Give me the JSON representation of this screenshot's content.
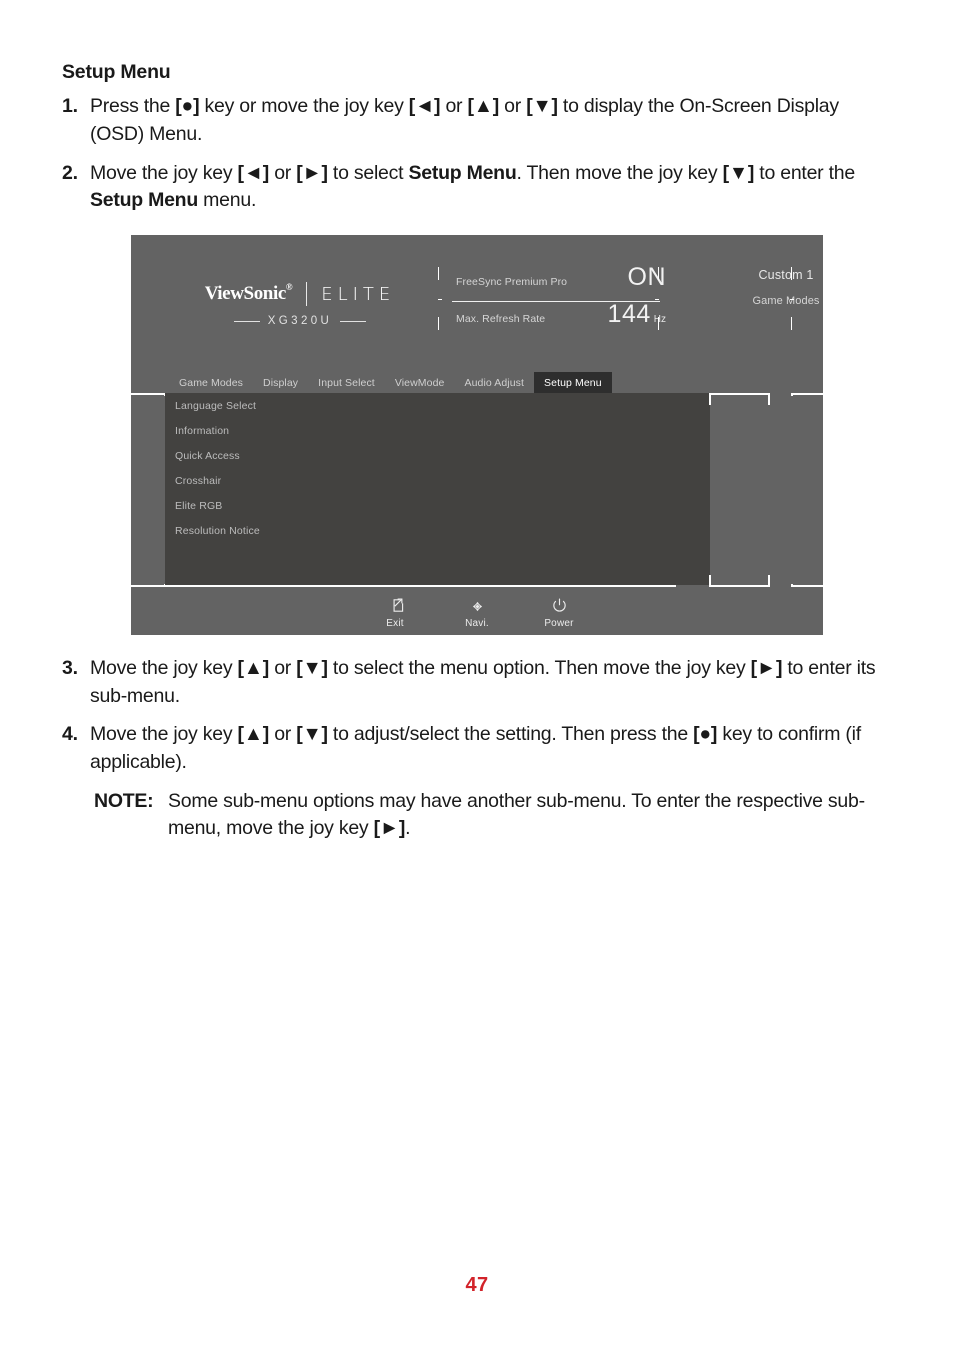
{
  "document": {
    "section_title": "Setup Menu",
    "steps_top": [
      {
        "num": "1.",
        "parts": [
          {
            "t": "Press the ",
            "bold": false
          },
          {
            "t": "[●]",
            "bold": true
          },
          {
            "t": " key or move the joy key ",
            "bold": false
          },
          {
            "t": "[◄]",
            "bold": true
          },
          {
            "t": " or ",
            "bold": false
          },
          {
            "t": "[▲]",
            "bold": true
          },
          {
            "t": " or ",
            "bold": false
          },
          {
            "t": "[▼]",
            "bold": true
          },
          {
            "t": " to display the On-Screen Display (OSD) Menu.",
            "bold": false
          }
        ]
      },
      {
        "num": "2.",
        "parts": [
          {
            "t": "Move the joy key ",
            "bold": false
          },
          {
            "t": "[◄]",
            "bold": true
          },
          {
            "t": " or ",
            "bold": false
          },
          {
            "t": "[►]",
            "bold": true
          },
          {
            "t": " to select ",
            "bold": false
          },
          {
            "t": "Setup Menu",
            "bold": true
          },
          {
            "t": ". Then move the joy key ",
            "bold": false
          },
          {
            "t": "[▼]",
            "bold": true
          },
          {
            "t": " to enter the ",
            "bold": false
          },
          {
            "t": "Setup Menu",
            "bold": true
          },
          {
            "t": " menu.",
            "bold": false
          }
        ]
      }
    ],
    "steps_bottom": [
      {
        "num": "3.",
        "parts": [
          {
            "t": "Move the joy key ",
            "bold": false
          },
          {
            "t": "[▲]",
            "bold": true
          },
          {
            "t": " or ",
            "bold": false
          },
          {
            "t": "[▼]",
            "bold": true
          },
          {
            "t": " to select the menu option. Then move the joy key ",
            "bold": false
          },
          {
            "t": "[►]",
            "bold": true
          },
          {
            "t": " to enter its sub-menu.",
            "bold": false
          }
        ]
      },
      {
        "num": "4.",
        "parts": [
          {
            "t": "Move the joy key ",
            "bold": false
          },
          {
            "t": "[▲]",
            "bold": true
          },
          {
            "t": " or ",
            "bold": false
          },
          {
            "t": "[▼]",
            "bold": true
          },
          {
            "t": " to adjust/select the setting. Then press the ",
            "bold": false
          },
          {
            "t": "[●]",
            "bold": true
          },
          {
            "t": " key to confirm (if applicable).",
            "bold": false
          }
        ]
      }
    ],
    "note": {
      "label": "NOTE:",
      "parts": [
        {
          "t": "Some sub-menu options may have another sub-menu. To enter the respective sub-menu, move the joy key ",
          "bold": false
        },
        {
          "t": "[►]",
          "bold": true
        },
        {
          "t": ".",
          "bold": false
        }
      ]
    },
    "page_number": "47"
  },
  "osd": {
    "brand": {
      "vendor": "ViewSonic",
      "vendor_mark": "®",
      "sub_brand": "ELITE",
      "model": "XG320U"
    },
    "status": [
      {
        "label": "FreeSync Premium Pro",
        "value": "ON",
        "unit": ""
      },
      {
        "label": "Max. Refresh Rate",
        "value": "144",
        "unit": "Hz"
      }
    ],
    "mode": {
      "value": "Custom 1",
      "label": "Game Modes"
    },
    "tabs": [
      {
        "label": "Game Modes",
        "active": false
      },
      {
        "label": "Display",
        "active": false
      },
      {
        "label": "Input Select",
        "active": false
      },
      {
        "label": "ViewMode",
        "active": false
      },
      {
        "label": "Audio Adjust",
        "active": false
      },
      {
        "label": "Setup Menu",
        "active": true
      }
    ],
    "submenu_items": [
      "Language Select",
      "Information",
      "Quick Access",
      "Crosshair",
      "Elite RGB",
      "Resolution Notice"
    ],
    "footer_buttons": [
      {
        "icon": "exit-icon",
        "label": "Exit"
      },
      {
        "icon": "navigate-icon",
        "label": "Navi."
      },
      {
        "icon": "power-icon",
        "label": "Power"
      }
    ],
    "colors": {
      "background": "#636363",
      "submenu_background": "#434240",
      "active_tab_background": "#2e2e2e",
      "text": "#d9d9d9",
      "accent_line": "#ffffff"
    }
  }
}
